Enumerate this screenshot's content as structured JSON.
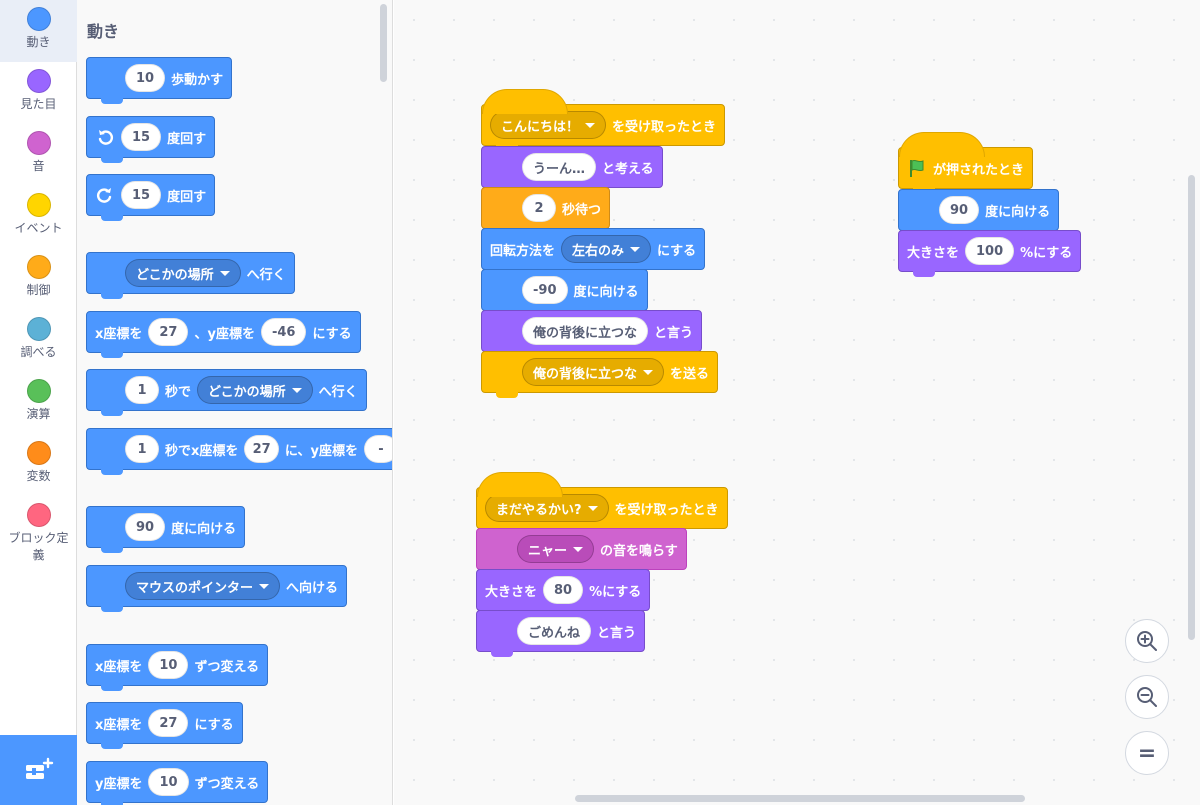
{
  "categories": [
    {
      "label": "動き",
      "color": "#4c97ff",
      "selected": true
    },
    {
      "label": "見た目",
      "color": "#9966ff",
      "selected": false
    },
    {
      "label": "音",
      "color": "#cf63cf",
      "selected": false
    },
    {
      "label": "イベント",
      "color": "#ffd500",
      "selected": false
    },
    {
      "label": "制御",
      "color": "#ffab19",
      "selected": false
    },
    {
      "label": "調べる",
      "color": "#5cb1d6",
      "selected": false
    },
    {
      "label": "演算",
      "color": "#59c059",
      "selected": false
    },
    {
      "label": "変数",
      "color": "#ff8c1a",
      "selected": false
    },
    {
      "label": "ブロック定",
      "label2": "義",
      "color": "#ff6680",
      "selected": false
    }
  ],
  "extension_icon": "add-extension-icon",
  "palette": {
    "title": "動き",
    "move": {
      "value": "10",
      "text": "歩動かす"
    },
    "turn_right": {
      "value": "15",
      "text": "度回す",
      "icon": "rotate-right-icon"
    },
    "turn_left": {
      "value": "15",
      "text": "度回す",
      "icon": "rotate-left-icon"
    },
    "goto": {
      "menu": "どこかの場所",
      "text": "へ行く"
    },
    "goto_xy": {
      "t1": "x座標を",
      "x": "27",
      "t2": "、y座標を",
      "y": "-46",
      "t3": "にする"
    },
    "glide": {
      "secs": "1",
      "t1": "秒で",
      "menu": "どこかの場所",
      "t2": "へ行く"
    },
    "glide_xy": {
      "secs": "1",
      "t1": "秒でx座標を",
      "x": "27",
      "t2": "に、y座標を",
      "y": "-"
    },
    "point_dir": {
      "value": "90",
      "text": "度に向ける"
    },
    "point_towards": {
      "menu": "マウスのポインター",
      "text": "へ向ける"
    },
    "change_x": {
      "t1": "x座標を",
      "value": "10",
      "t2": "ずつ変える"
    },
    "set_x": {
      "t1": "x座標を",
      "value": "27",
      "t2": "にする"
    },
    "change_y": {
      "t1": "y座標を",
      "value": "10",
      "t2": "ずつ変える"
    }
  },
  "scripts": {
    "s1": {
      "hat": {
        "menu": "こんにちは！",
        "text": "を受け取ったとき"
      },
      "think": {
        "value": "うーん…",
        "text": "と考える"
      },
      "wait": {
        "value": "2",
        "text": "秒待つ"
      },
      "rotation": {
        "t1": "回転方法を",
        "menu": "左右のみ",
        "t2": "にする"
      },
      "point": {
        "value": "-90",
        "text": "度に向ける"
      },
      "say": {
        "value": "俺の背後に立つな",
        "text": "と言う"
      },
      "broadcast": {
        "menu": "俺の背後に立つな",
        "text": "を送る"
      }
    },
    "s2": {
      "hat": {
        "text": "が押されたとき",
        "icon": "green-flag-icon"
      },
      "point": {
        "value": "90",
        "text": "度に向ける"
      },
      "size": {
        "t1": "大きさを",
        "value": "100",
        "t2": "%にする"
      }
    },
    "s3": {
      "hat": {
        "menu": "まだやるかい?",
        "text": "を受け取ったとき"
      },
      "sound": {
        "menu": "ニャー",
        "text": "の音を鳴らす"
      },
      "size": {
        "t1": "大きさを",
        "value": "80",
        "t2": "%にする"
      },
      "say": {
        "value": "ごめんね",
        "text": "と言う"
      }
    }
  },
  "zoom": {
    "in": "zoom-in-icon",
    "out": "zoom-out-icon",
    "reset": "zoom-reset-icon",
    "reset_label": "="
  }
}
